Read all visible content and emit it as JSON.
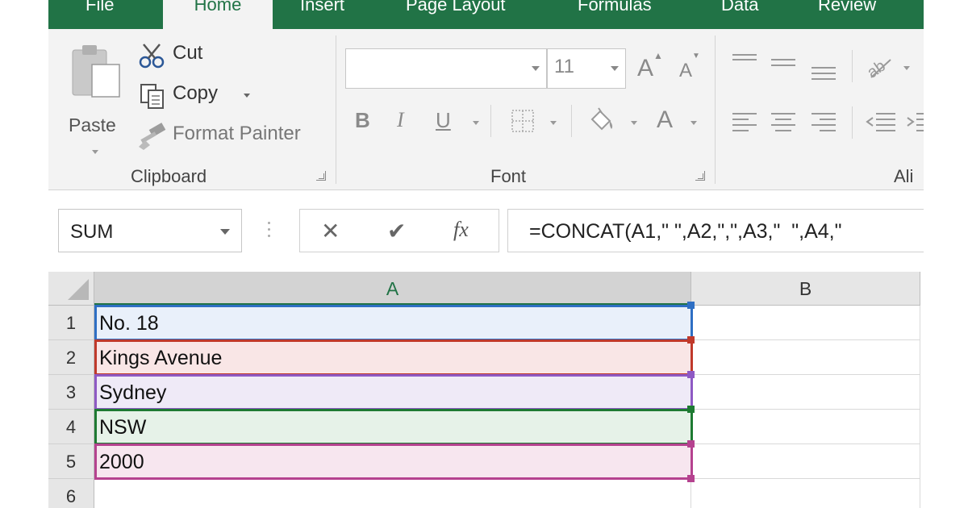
{
  "tabs": [
    {
      "label": "File",
      "active": false
    },
    {
      "label": "Home",
      "active": true
    },
    {
      "label": "Insert",
      "active": false
    },
    {
      "label": "Page Layout",
      "active": false
    },
    {
      "label": "Formulas",
      "active": false
    },
    {
      "label": "Data",
      "active": false
    },
    {
      "label": "Review",
      "active": false
    }
  ],
  "clipboard": {
    "paste_label": "Paste",
    "cut_label": "Cut",
    "copy_label": "Copy",
    "format_painter_label": "Format Painter",
    "group_label": "Clipboard"
  },
  "font": {
    "font_name": "",
    "font_size": "11",
    "grow_label": "A",
    "shrink_label": "A",
    "bold_label": "B",
    "italic_label": "I",
    "underline_label": "U",
    "font_color_label": "A",
    "group_label": "Font"
  },
  "alignment": {
    "group_label": "Ali"
  },
  "formula_bar": {
    "name_box": "SUM",
    "cancel_glyph": "✕",
    "enter_glyph": "✔",
    "fx_label": "fx",
    "formula": "=CONCAT(A1,\" \",A2,\",\",A3,\"  \",A4,\""
  },
  "grid": {
    "columns": [
      "A",
      "B"
    ],
    "rows": [
      "1",
      "2",
      "3",
      "4",
      "5",
      "6"
    ],
    "cells_a": [
      "No. 18",
      "Kings Avenue",
      "Sydney",
      "NSW",
      "2000",
      ""
    ]
  },
  "colors": {
    "accent": "#217346",
    "ref1": "#2e6fc4",
    "ref2": "#c0392b",
    "ref3": "#8e59c4",
    "ref4": "#1e7a32",
    "ref5": "#b5428f"
  }
}
